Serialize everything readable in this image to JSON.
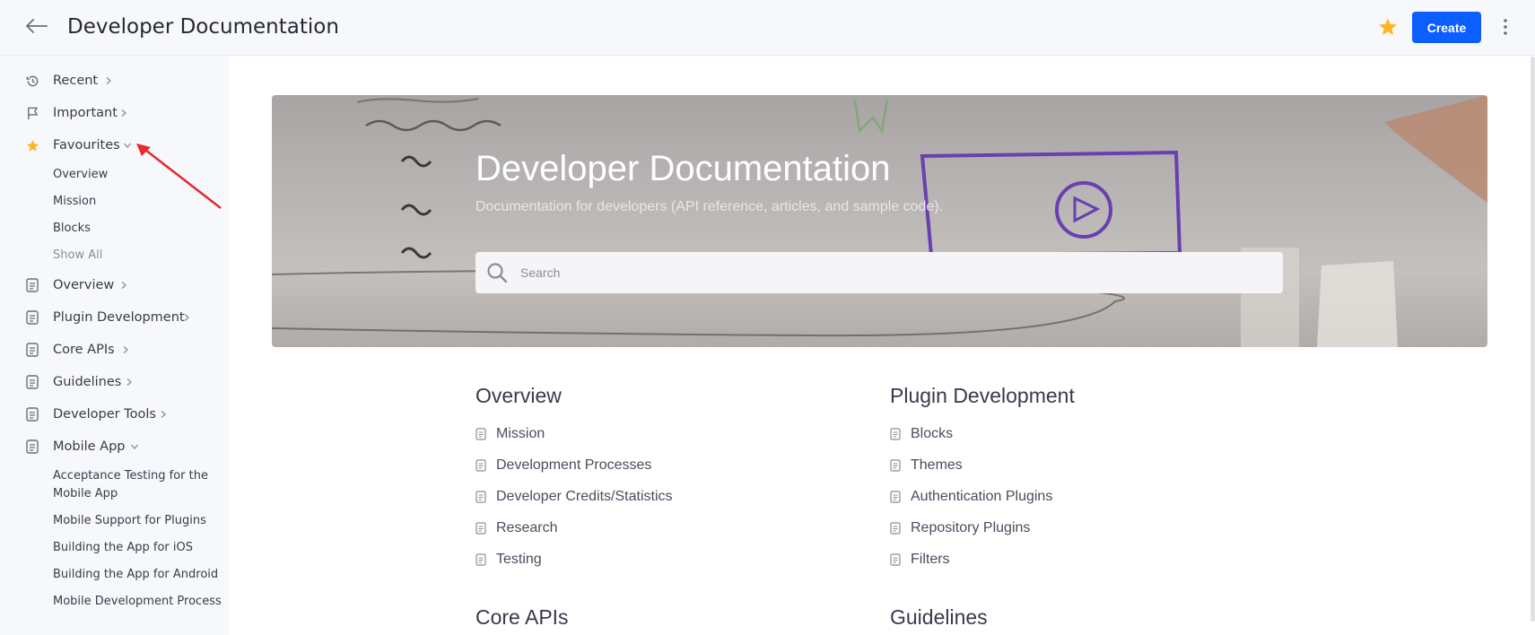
{
  "header": {
    "title": "Developer Documentation",
    "create_label": "Create"
  },
  "sidebar": {
    "items": [
      {
        "label": "Recent",
        "icon": "history-icon",
        "expanded": false
      },
      {
        "label": "Important",
        "icon": "flag-icon",
        "expanded": false
      },
      {
        "label": "Favourites",
        "icon": "star-icon",
        "expanded": true
      },
      {
        "label": "Overview",
        "icon": "document-icon",
        "expanded": false
      },
      {
        "label": "Plugin Development",
        "icon": "document-icon",
        "expanded": false
      },
      {
        "label": "Core APIs",
        "icon": "document-icon",
        "expanded": false
      },
      {
        "label": "Guidelines",
        "icon": "document-icon",
        "expanded": false
      },
      {
        "label": "Developer Tools",
        "icon": "document-icon",
        "expanded": false
      },
      {
        "label": "Mobile App",
        "icon": "document-icon",
        "expanded": true
      }
    ],
    "favourites": [
      "Overview",
      "Mission",
      "Blocks",
      "Show All"
    ],
    "mobile_app": [
      "Acceptance Testing for the Mobile App",
      "Mobile Support for Plugins",
      "Building the App for iOS",
      "Building the App for Android",
      "Mobile Development Process"
    ]
  },
  "hero": {
    "title": "Developer Documentation",
    "subtitle": "Documentation for developers (API reference, articles, and sample code).",
    "search_placeholder": "Search"
  },
  "sections": {
    "overview": {
      "title": "Overview",
      "links": [
        "Mission",
        "Development Processes",
        "Developer Credits/Statistics",
        "Research",
        "Testing"
      ]
    },
    "plugin_development": {
      "title": "Plugin Development",
      "links": [
        "Blocks",
        "Themes",
        "Authentication Plugins",
        "Repository Plugins",
        "Filters"
      ]
    },
    "core_apis": {
      "title": "Core APIs"
    },
    "guidelines": {
      "title": "Guidelines"
    }
  },
  "colors": {
    "accent": "#0b5fff",
    "star": "#ffb51f",
    "annotation": "#e8282b"
  }
}
